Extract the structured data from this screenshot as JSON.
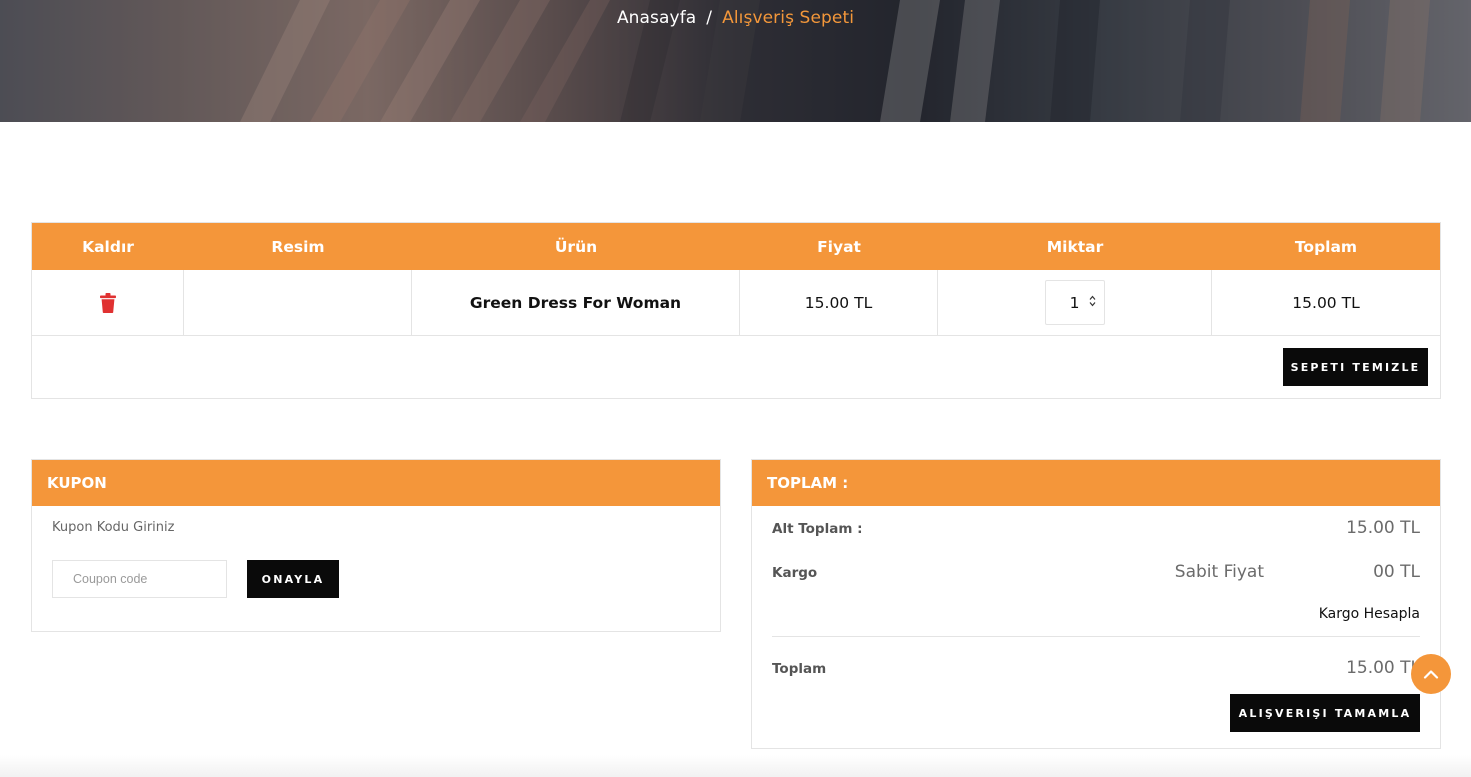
{
  "breadcrumb": {
    "home": "Anasayfa",
    "separator": "/",
    "current": "Alışveriş Sepeti"
  },
  "cart": {
    "headers": [
      "Kaldır",
      "Resim",
      "Ürün",
      "Fiyat",
      "Miktar",
      "Toplam"
    ],
    "rows": [
      {
        "product": "Green Dress For Woman",
        "price": "15.00 TL",
        "quantity": "1",
        "total": "15.00 TL"
      }
    ],
    "clear_label": "SEPETI TEMIZLE"
  },
  "coupon": {
    "title": "KUPON",
    "instruction": "Kupon Kodu Giriniz",
    "placeholder": "Coupon code",
    "apply_label": "ONAYLA"
  },
  "totals": {
    "title": "TOPLAM :",
    "subtotal_label": "Alt Toplam :",
    "subtotal_value": "15.00 TL",
    "shipping_label": "Kargo",
    "shipping_type": "Sabit Fiyat",
    "shipping_value": "00 TL",
    "shipping_calc": "Kargo Hesapla",
    "total_label": "Toplam",
    "total_value": "15.00 TL",
    "checkout_label": "ALIŞVERIŞI TAMAMLA"
  },
  "colors": {
    "accent": "#f4963a",
    "delete": "#e03131",
    "button": "#0a0a0a"
  },
  "icons": {
    "remove": "trash-icon",
    "scroll_top": "chevron-up-icon"
  }
}
